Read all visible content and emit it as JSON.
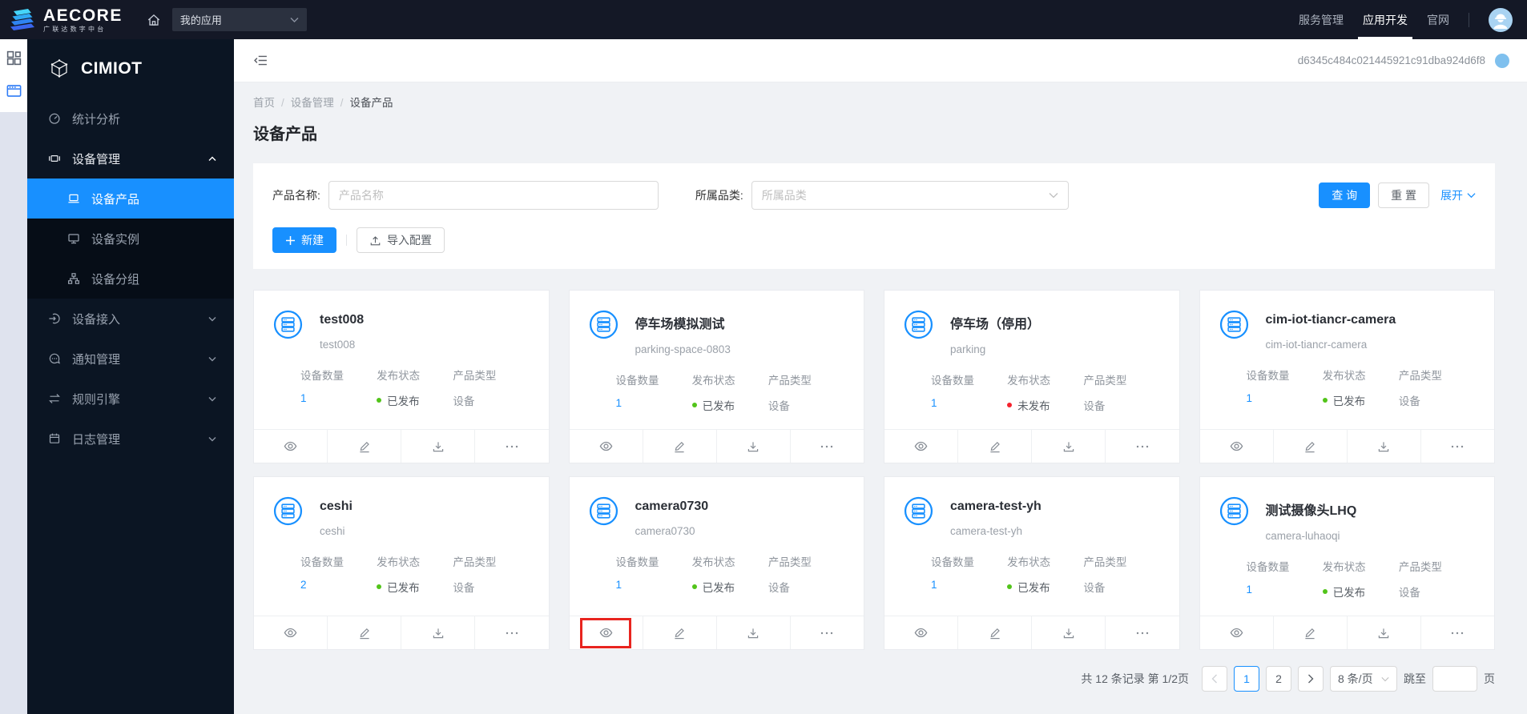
{
  "colors": {
    "accent": "#1890ff",
    "published": "#52c41a",
    "unpublished": "#f5222d",
    "highlight": "#e8241f"
  },
  "topbar": {
    "logo_title": "AECORE",
    "logo_subtitle": "广联达数字中台",
    "app_select_value": "我的应用",
    "links": [
      {
        "label": "服务管理",
        "active": false
      },
      {
        "label": "应用开发",
        "active": true
      },
      {
        "label": "官网",
        "active": false
      }
    ]
  },
  "sidebar": {
    "brand": "CIMIOT",
    "items": [
      {
        "label": "统计分析"
      },
      {
        "label": "设备管理"
      },
      {
        "label": "设备产品"
      },
      {
        "label": "设备实例"
      },
      {
        "label": "设备分组"
      },
      {
        "label": "设备接入"
      },
      {
        "label": "通知管理"
      },
      {
        "label": "规则引擎"
      },
      {
        "label": "日志管理"
      }
    ]
  },
  "header": {
    "session_id": "d6345c484c021445921c91dba924d6f8"
  },
  "breadcrumb": [
    "首页",
    "设备管理",
    "设备产品"
  ],
  "page_title": "设备产品",
  "filter": {
    "name_label": "产品名称:",
    "name_placeholder": "产品名称",
    "category_label": "所属品类:",
    "category_placeholder": "所属品类",
    "search_label": "查 询",
    "reset_label": "重 置",
    "expand_label": "展开"
  },
  "toolbar": {
    "create_label": "新建",
    "import_label": "导入配置"
  },
  "cards": {
    "stat_labels": [
      "设备数量",
      "发布状态",
      "产品类型"
    ],
    "items": [
      {
        "title": "test008",
        "subtitle": "test008",
        "count": "1",
        "status": "已发布",
        "status_color": "#52c41a",
        "type": "设备",
        "view_highlighted": false
      },
      {
        "title": "停车场模拟测试",
        "subtitle": "parking-space-0803",
        "count": "1",
        "status": "已发布",
        "status_color": "#52c41a",
        "type": "设备",
        "view_highlighted": false
      },
      {
        "title": "停车场（停用）",
        "subtitle": "parking",
        "count": "1",
        "status": "未发布",
        "status_color": "#f5222d",
        "type": "设备",
        "view_highlighted": false
      },
      {
        "title": "cim-iot-tiancr-camera",
        "subtitle": "cim-iot-tiancr-camera",
        "count": "1",
        "status": "已发布",
        "status_color": "#52c41a",
        "type": "设备",
        "view_highlighted": false
      },
      {
        "title": "ceshi",
        "subtitle": "ceshi",
        "count": "2",
        "status": "已发布",
        "status_color": "#52c41a",
        "type": "设备",
        "view_highlighted": false
      },
      {
        "title": "camera0730",
        "subtitle": "camera0730",
        "count": "1",
        "status": "已发布",
        "status_color": "#52c41a",
        "type": "设备",
        "view_highlighted": true
      },
      {
        "title": "camera-test-yh",
        "subtitle": "camera-test-yh",
        "count": "1",
        "status": "已发布",
        "status_color": "#52c41a",
        "type": "设备",
        "view_highlighted": false
      },
      {
        "title": "测试摄像头LHQ",
        "subtitle": "camera-luhaoqi",
        "count": "1",
        "status": "已发布",
        "status_color": "#52c41a",
        "type": "设备",
        "view_highlighted": false
      }
    ]
  },
  "pagination": {
    "summary": "共 12 条记录 第 1/2页",
    "pages": [
      "1",
      "2"
    ],
    "active_page": "1",
    "page_size": "8 条/页",
    "jump_prefix": "跳至",
    "jump_suffix": "页"
  }
}
